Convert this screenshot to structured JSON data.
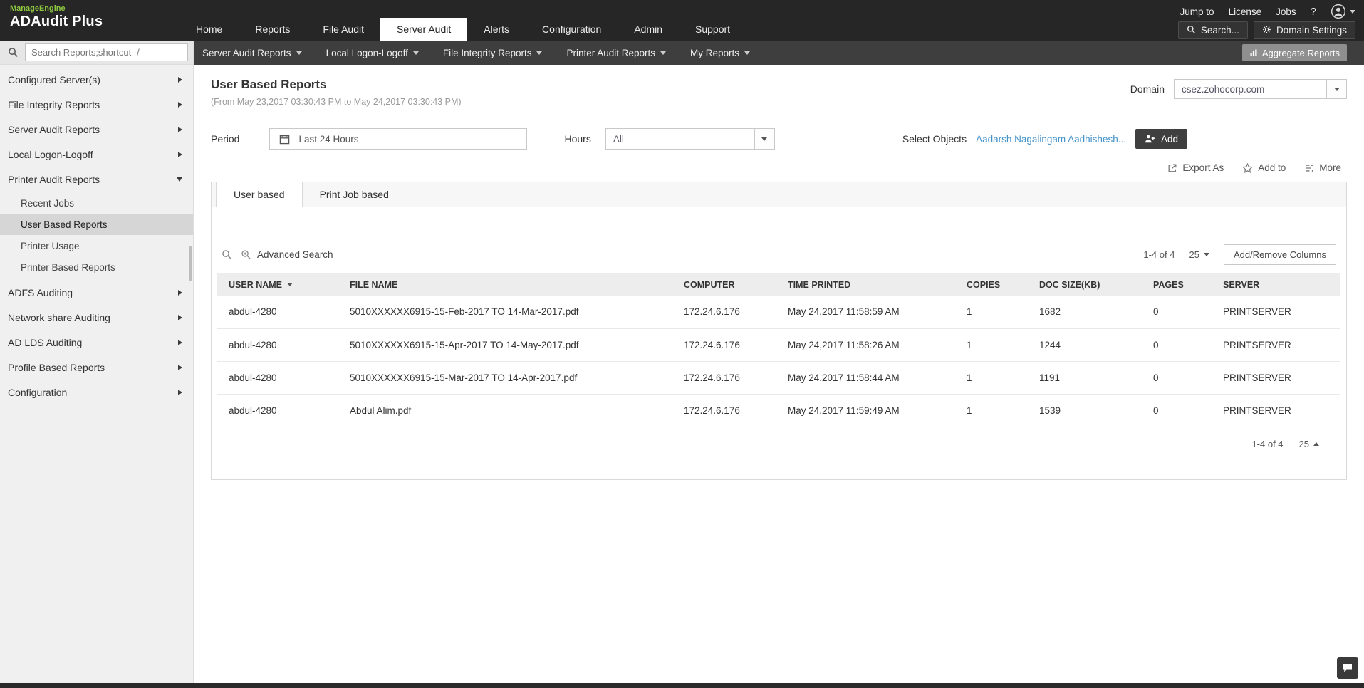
{
  "brand": {
    "vendor": "ManageEngine",
    "product": "ADAudit Plus"
  },
  "topnav": {
    "items": [
      {
        "label": "Home"
      },
      {
        "label": "Reports"
      },
      {
        "label": "File Audit"
      },
      {
        "label": "Server Audit"
      },
      {
        "label": "Alerts"
      },
      {
        "label": "Configuration"
      },
      {
        "label": "Admin"
      },
      {
        "label": "Support"
      }
    ],
    "links": [
      "Jump to",
      "License",
      "Jobs"
    ],
    "help": "?",
    "search_label": "Search...",
    "domain_settings_label": "Domain Settings"
  },
  "subnav": {
    "items": [
      {
        "label": "Server Audit Reports"
      },
      {
        "label": "Local Logon-Logoff"
      },
      {
        "label": "File Integrity Reports"
      },
      {
        "label": "Printer Audit Reports"
      },
      {
        "label": "My Reports"
      }
    ],
    "aggregate_label": "Aggregate Reports"
  },
  "sidebar": {
    "search_placeholder": "Search Reports;shortcut -/",
    "items": [
      {
        "label": "Configured Server(s)"
      },
      {
        "label": "File Integrity Reports"
      },
      {
        "label": "Server Audit Reports"
      },
      {
        "label": "Local Logon-Logoff"
      },
      {
        "label": "Printer Audit Reports"
      },
      {
        "label": "ADFS Auditing"
      },
      {
        "label": "Network share Auditing"
      },
      {
        "label": "AD LDS Auditing"
      },
      {
        "label": "Profile Based Reports"
      },
      {
        "label": "Configuration"
      }
    ],
    "printer_children": [
      {
        "label": "Recent Jobs"
      },
      {
        "label": "User Based Reports"
      },
      {
        "label": "Printer Usage"
      },
      {
        "label": "Printer Based Reports"
      }
    ]
  },
  "main": {
    "title": "User Based Reports",
    "subtitle": "(From May 23,2017 03:30:43 PM to May 24,2017 03:30:43 PM)",
    "domain": {
      "label": "Domain",
      "value": "csez.zohocorp.com"
    },
    "filters": {
      "period_label": "Period",
      "period_value": "Last 24 Hours",
      "hours_label": "Hours",
      "hours_value": "All",
      "select_objects_label": "Select Objects",
      "selected_objects": "Aadarsh Nagalingam Aadhishesh...",
      "add_button": "Add"
    },
    "actions": {
      "export": "Export As",
      "add_to": "Add to",
      "more": "More"
    },
    "tabs": [
      {
        "label": "User based"
      },
      {
        "label": "Print Job based"
      }
    ],
    "toolbar": {
      "advanced_search": "Advanced Search",
      "range": "1-4 of 4",
      "page_size": "25",
      "columns_button": "Add/Remove Columns"
    },
    "table": {
      "columns": [
        "USER NAME",
        "FILE NAME",
        "COMPUTER",
        "TIME PRINTED",
        "COPIES",
        "DOC SIZE(KB)",
        "PAGES",
        "SERVER"
      ],
      "rows": [
        [
          "abdul-4280",
          "5010XXXXXX6915-15-Feb-2017 TO 14-Mar-2017.pdf",
          "172.24.6.176",
          "May 24,2017 11:58:59 AM",
          "1",
          "1682",
          "0",
          "PRINTSERVER"
        ],
        [
          "abdul-4280",
          "5010XXXXXX6915-15-Apr-2017 TO 14-May-2017.pdf",
          "172.24.6.176",
          "May 24,2017 11:58:26 AM",
          "1",
          "1244",
          "0",
          "PRINTSERVER"
        ],
        [
          "abdul-4280",
          "5010XXXXXX6915-15-Mar-2017 TO 14-Apr-2017.pdf",
          "172.24.6.176",
          "May 24,2017 11:58:44 AM",
          "1",
          "1191",
          "0",
          "PRINTSERVER"
        ],
        [
          "abdul-4280",
          "Abdul Alim.pdf",
          "172.24.6.176",
          "May 24,2017 11:59:49 AM",
          "1",
          "1539",
          "0",
          "PRINTSERVER"
        ]
      ]
    },
    "footer": {
      "range": "1-4 of 4",
      "page_size": "25"
    }
  },
  "colors": {
    "header_bg": "#262626",
    "brand_green": "#8dc63f",
    "link_blue": "#4191c9",
    "selected_item_gray": "#d6d6d6"
  }
}
